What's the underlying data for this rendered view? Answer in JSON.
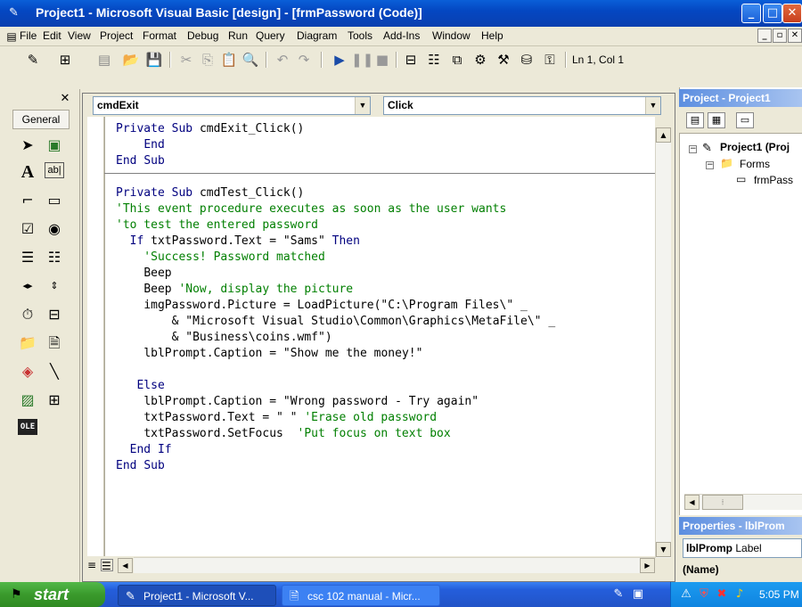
{
  "window": {
    "title": "Project1 - Microsoft Visual Basic [design] - [frmPassword (Code)]",
    "controls": {
      "minimize": "_",
      "maximize": "□",
      "close": "✕"
    }
  },
  "menubar": {
    "items": [
      "File",
      "Edit",
      "View",
      "Project",
      "Format",
      "Debug",
      "Run",
      "Query",
      "Diagram",
      "Tools",
      "Add-Ins",
      "Window",
      "Help"
    ],
    "mdi_controls": [
      "_",
      "▫",
      "✕"
    ]
  },
  "toolbar": {
    "position_text": "Ln 1, Col 1"
  },
  "toolbox": {
    "close": "✕",
    "tab_label": "General",
    "tools": [
      "pointer-icon",
      "picturebox-icon",
      "label-icon",
      "textbox-icon",
      "frame-icon",
      "commandbutton-icon",
      "checkbox-icon",
      "optionbutton-icon",
      "combobox-icon",
      "listbox-icon",
      "hscrollbar-icon",
      "vscrollbar-icon",
      "timer-icon",
      "drivelistbox-icon",
      "dirlistbox-icon",
      "filelistbox-icon",
      "shape-icon",
      "line-icon",
      "image-icon",
      "data-icon",
      "ole-icon"
    ]
  },
  "code_window": {
    "object_combo": "cmdExit",
    "procedure_combo": "Click",
    "lines": [
      {
        "text": "Private Sub cmdExit_Click()",
        "type": "kw"
      },
      {
        "text": "    End",
        "type": "kw"
      },
      {
        "text": "End Sub",
        "type": "kw"
      },
      {
        "text": "",
        "type": "pl"
      },
      {
        "text": "Private Sub cmdTest_Click()",
        "type": "kw"
      },
      {
        "text": "'This event procedure executes as soon as the user wants",
        "type": "cm"
      },
      {
        "text": "'to test the entered password",
        "type": "cm"
      },
      {
        "text": "  If txtPassword.Text = \"Sams\" Then",
        "type": "mix"
      },
      {
        "text": "    'Success! Password matched",
        "type": "cm"
      },
      {
        "text": "    Beep",
        "type": "pl"
      },
      {
        "text": "    Beep 'Now, display the picture",
        "type": "mix"
      },
      {
        "text": "    imgPassword.Picture = LoadPicture(\"C:\\Program Files\\\" _",
        "type": "pl"
      },
      {
        "text": "        & \"Microsoft Visual Studio\\Common\\Graphics\\MetaFile\\\" _",
        "type": "pl"
      },
      {
        "text": "        & \"Business\\coins.wmf\")",
        "type": "pl"
      },
      {
        "text": "    lblPrompt.Caption = \"Show me the money!\"",
        "type": "pl"
      },
      {
        "text": "",
        "type": "pl"
      },
      {
        "text": "   Else",
        "type": "kw"
      },
      {
        "text": "    lblPrompt.Caption = \"Wrong password - Try again\"",
        "type": "pl"
      },
      {
        "text": "    txtPassword.Text = \" \" 'Erase old password",
        "type": "mix"
      },
      {
        "text": "    txtPassword.SetFocus  'Put focus on text box",
        "type": "mix"
      },
      {
        "text": "  End If",
        "type": "kw"
      },
      {
        "text": "End Sub",
        "type": "kw"
      }
    ],
    "view_buttons": [
      "≡",
      "☰"
    ]
  },
  "project_explorer": {
    "title": "Project - Project1",
    "tree": [
      {
        "label": "Project1 (Proj",
        "level": 0
      },
      {
        "label": "Forms",
        "level": 1
      },
      {
        "label": "frmPass",
        "level": 2
      }
    ]
  },
  "properties": {
    "title": "Properties - lblProm",
    "object": "lblPromp",
    "object_type": "Label",
    "first_row": "(Name)"
  },
  "taskbar": {
    "start_label": "start",
    "tasks": [
      {
        "label": "Project1 - Microsoft V...",
        "active": true
      },
      {
        "label": "csc 102 manual - Micr...",
        "active": false
      }
    ],
    "clock": "5:05 PM"
  },
  "colors": {
    "keyword": "#00007f",
    "comment": "#007f00",
    "titlebar": "#0a5fd8"
  }
}
